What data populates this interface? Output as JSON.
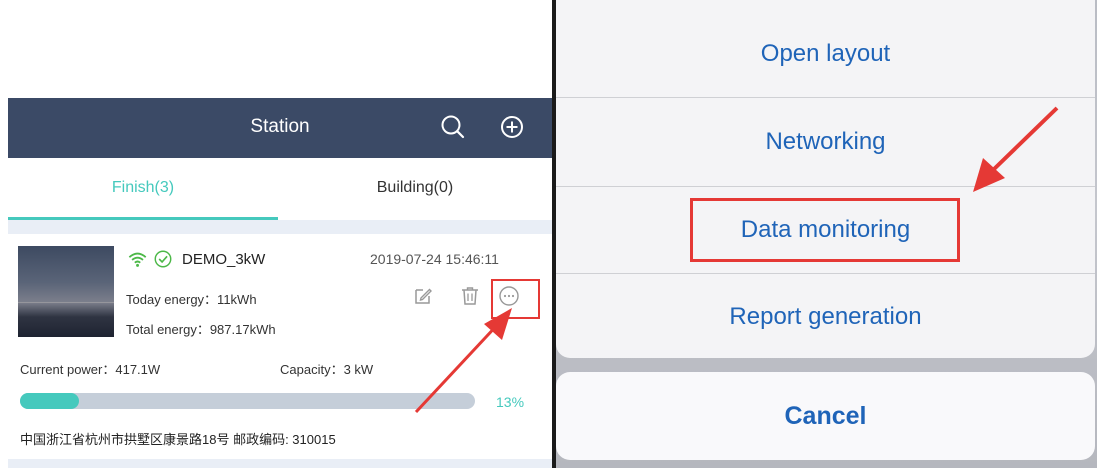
{
  "station_app": {
    "header": {
      "title": "Station",
      "search_icon": "search-icon",
      "add_icon": "add-circle-icon"
    },
    "tabs": [
      {
        "label": "Finish(3)",
        "active": true
      },
      {
        "label": "Building(0)",
        "active": false
      }
    ],
    "station": {
      "name": "DEMO_3kW",
      "datetime": "2019-07-24 15:46:11",
      "today_energy": "Today energy：11kWh",
      "total_energy": "Total energy：987.17kWh",
      "current_power": "Current power：417.1W",
      "capacity": "Capacity：3 kW",
      "progress_percent": 13,
      "progress_label": "13%",
      "address": "中国浙江省杭州市拱墅区康景路18号 邮政编码: 310015",
      "status_icons": [
        "wifi-signal-icon",
        "check-circle-icon"
      ],
      "actions": [
        "edit-icon",
        "delete-icon",
        "more-icon"
      ]
    }
  },
  "action_sheet": {
    "items": [
      {
        "label": "Open layout"
      },
      {
        "label": "Networking"
      },
      {
        "label": "Data monitoring"
      },
      {
        "label": "Report generation"
      }
    ],
    "cancel_label": "Cancel"
  },
  "colors": {
    "header_bg": "#3b4a66",
    "accent_teal": "#45c9bd",
    "ios_blue": "#1f64b8",
    "highlight_red": "#e53935"
  }
}
